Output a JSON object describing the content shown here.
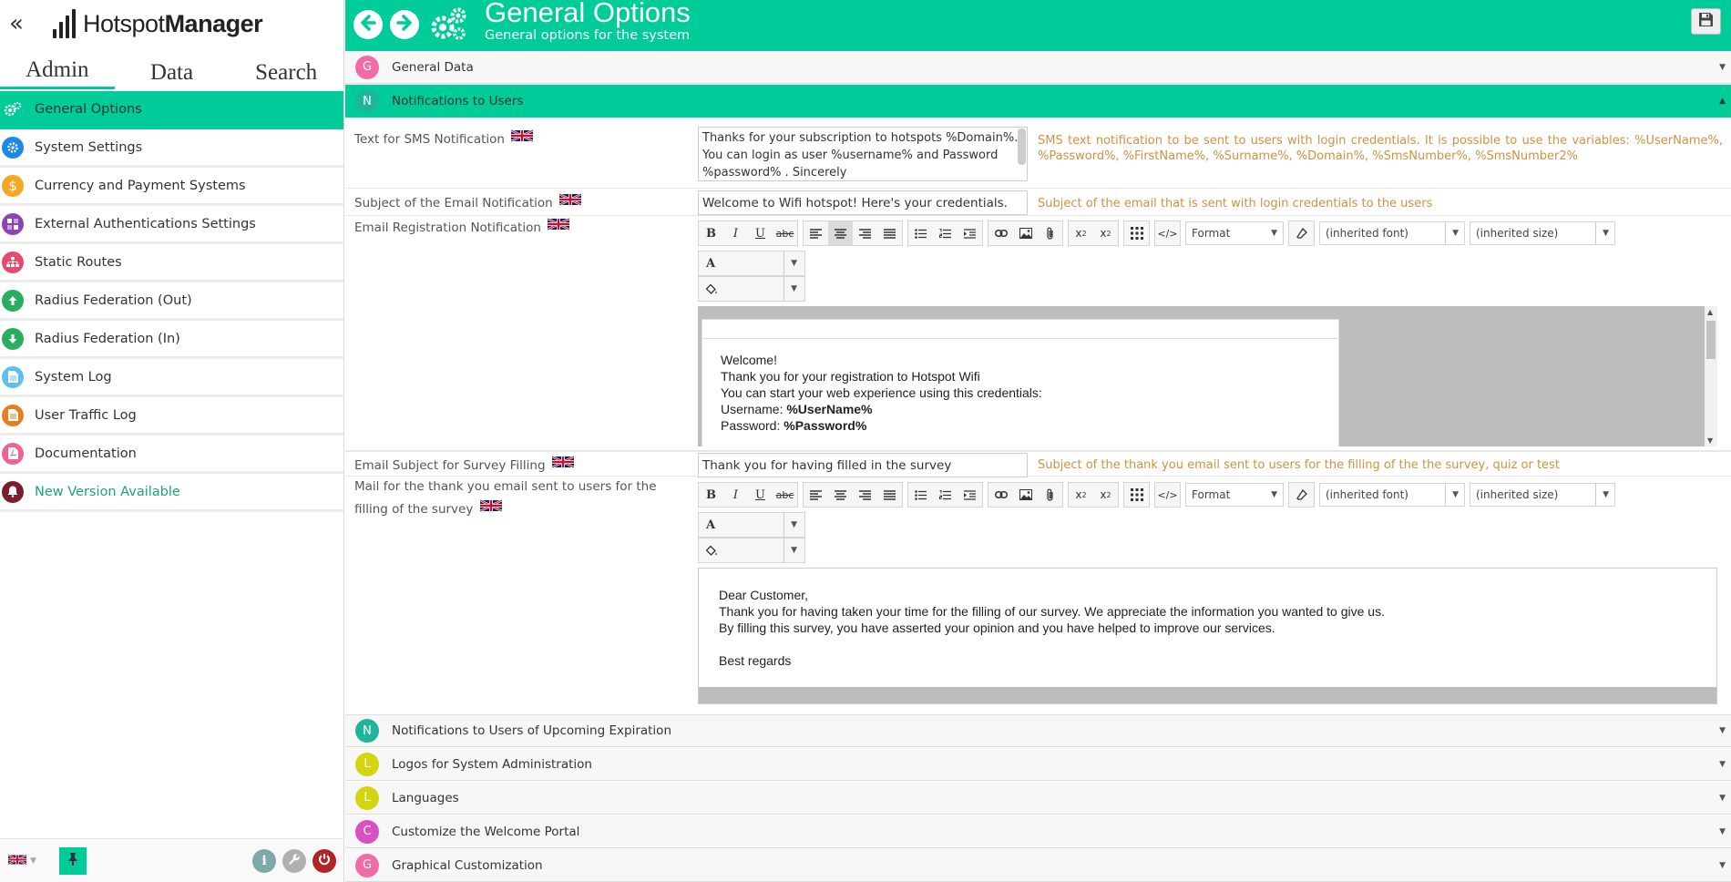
{
  "app": {
    "logo_regular": "Hotspot",
    "logo_bold": "Manager"
  },
  "sidebar": {
    "collapse_icon": "double-chevron-left-icon",
    "tabs": [
      {
        "label": "Admin"
      },
      {
        "label": "Data"
      },
      {
        "label": "Search"
      }
    ],
    "active_tab": "Admin",
    "items": [
      {
        "label": "General Options",
        "icon": "gears-icon",
        "color": "#00cc99"
      },
      {
        "label": "System Settings",
        "icon": "gear-icon",
        "color": "#1e88e5"
      },
      {
        "label": "Currency and Payment Systems",
        "icon": "dollar-icon",
        "color": "#f5a623"
      },
      {
        "label": "External Authentications Settings",
        "icon": "puzzle-icon",
        "color": "#8e44ad"
      },
      {
        "label": "Static Routes",
        "icon": "sitemap-icon",
        "color": "#e84a6b"
      },
      {
        "label": "Radius Federation (Out)",
        "icon": "arrow-up-circle-icon",
        "color": "#27ae60"
      },
      {
        "label": "Radius Federation (In)",
        "icon": "arrow-down-circle-icon",
        "color": "#27ae60"
      },
      {
        "label": "System Log",
        "icon": "file-icon",
        "color": "#5bc0eb"
      },
      {
        "label": "User Traffic Log",
        "icon": "file-list-icon",
        "color": "#e67e22"
      },
      {
        "label": "Documentation",
        "icon": "pdf-icon",
        "color": "#f06292"
      },
      {
        "label": "New Version Available",
        "icon": "bell-icon",
        "color": "#7b1d2e"
      }
    ],
    "footer": {
      "language_flag": "uk-flag-icon",
      "pin_icon": "pin-icon",
      "info_icon": "info-icon",
      "wrench_icon": "wrench-icon",
      "power_icon": "power-icon"
    }
  },
  "header": {
    "title": "General Options",
    "subtitle": "General options for the system",
    "back_icon": "arrow-left-icon",
    "forward_icon": "arrow-right-icon",
    "section_icon": "gears-icon",
    "save_icon": "floppy-disk-icon",
    "color": "#00cc99"
  },
  "sections": [
    {
      "badge": "G",
      "label": "General Data",
      "color": "#f06ba8",
      "expanded": false
    },
    {
      "badge": "N",
      "label": "Notifications to Users",
      "color": "#1fb59b",
      "expanded": true
    },
    {
      "badge": "N",
      "label": "Notifications to Users of Upcoming Expiration",
      "color": "#1fb59b",
      "expanded": false
    },
    {
      "badge": "L",
      "label": "Logos for System Administration",
      "color": "#d4d40f",
      "expanded": false
    },
    {
      "badge": "L",
      "label": "Languages",
      "color": "#d4d40f",
      "expanded": false
    },
    {
      "badge": "C",
      "label": "Customize the Welcome Portal",
      "color": "#d94fc4",
      "expanded": false
    },
    {
      "badge": "G",
      "label": "Graphical Customization",
      "color": "#f06ba8",
      "expanded": false
    }
  ],
  "notifications": {
    "sms": {
      "label": "Text for SMS Notification",
      "value": "Thanks for your subscription to hotspots %Domain%. You can login as user %username% and  Password %password% . Sincerely",
      "hint": "SMS text notification to be sent to users with login credentials. It is possible to use the variables: %UserName%, %Password%, %FirstName%, %Surname%, %Domain%, %SmsNumber%, %SmsNumber2%"
    },
    "email_subject": {
      "label": "Subject of the Email Notification",
      "value": "Welcome to Wifi hotspot! Here's your credentials.",
      "hint": "Subject of the email that is sent with login credentials to the users"
    },
    "email_body": {
      "label": "Email Registration Notification",
      "lines": [
        "Welcome!",
        "Thank you  for your registration to Hotspot Wifi",
        "You can start your web experience using this credentials:"
      ],
      "username_label": "Username:",
      "username_var": "%UserName%",
      "password_label": "Password:",
      "password_var": "%Password%"
    },
    "survey_subject": {
      "label": "Email Subject for Survey Filling",
      "value": "Thank you for having filled in the survey",
      "hint": "Subject of the thank you email sent to users for the filling of the the survey, quiz or test"
    },
    "survey_body": {
      "label": "Mail for the thank you email sent to users for the filling of the survey",
      "lines": [
        "Dear Customer,",
        "Thank you for having taken your time for the filling of our survey. We appreciate the information you wanted to give us.",
        "By filling this survey, you have asserted your opinion and you have helped to improve our services.",
        "",
        "Best regards"
      ]
    }
  },
  "editor_toolbar": {
    "format": "Format",
    "font": "(inherited font)",
    "size": "(inherited size)",
    "text_color_glyph": "A",
    "bg_color_icon": "paint-bucket-icon",
    "buttons": [
      "bold-icon",
      "italic-icon",
      "underline-icon",
      "strikethrough-icon",
      "align-left-icon",
      "align-center-icon",
      "align-right-icon",
      "align-justify-icon",
      "bullet-list-icon",
      "numbered-list-icon",
      "indent-icon",
      "link-icon",
      "image-icon",
      "attachment-icon",
      "subscript-icon",
      "superscript-icon",
      "table-icon",
      "source-code-icon",
      "eraser-icon"
    ]
  }
}
